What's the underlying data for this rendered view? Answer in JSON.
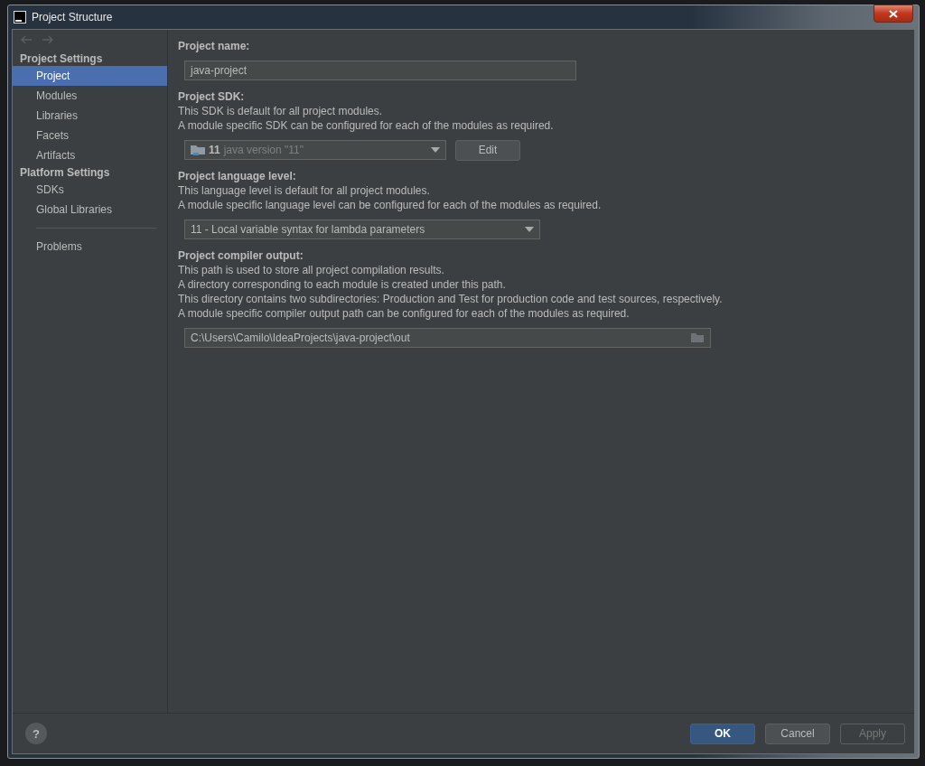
{
  "window": {
    "title": "Project Structure"
  },
  "sidebar": {
    "nav": [
      {
        "kind": "back",
        "disabled": true
      },
      {
        "kind": "forward",
        "disabled": true
      }
    ],
    "entries": [
      {
        "kind": "header",
        "label": "Project Settings"
      },
      {
        "kind": "item",
        "label": "Project",
        "selected": true
      },
      {
        "kind": "item",
        "label": "Modules",
        "selected": false
      },
      {
        "kind": "item",
        "label": "Libraries",
        "selected": false
      },
      {
        "kind": "item",
        "label": "Facets",
        "selected": false
      },
      {
        "kind": "item",
        "label": "Artifacts",
        "selected": false
      },
      {
        "kind": "header",
        "label": "Platform Settings"
      },
      {
        "kind": "item",
        "label": "SDKs",
        "selected": false
      },
      {
        "kind": "item",
        "label": "Global Libraries",
        "selected": false
      },
      {
        "kind": "divider"
      },
      {
        "kind": "item",
        "label": "Problems",
        "selected": false
      }
    ]
  },
  "sections": [
    {
      "kind": "text",
      "title": "Project name:",
      "value": "java-project"
    },
    {
      "kind": "sdk",
      "title": "Project SDK:",
      "lines": [
        "This SDK is default for all project modules.",
        "A module specific SDK can be configured for each of the modules as required."
      ],
      "sdk_version": "11",
      "sdk_name": "java version \"11\"",
      "button": "Edit"
    },
    {
      "kind": "combo",
      "title": "Project language level:",
      "lines": [
        "This language level is default for all project modules.",
        "A module specific language level can be configured for each of the modules as required."
      ],
      "value": "11 - Local variable syntax for lambda parameters"
    },
    {
      "kind": "path",
      "title": "Project compiler output:",
      "lines": [
        "This path is used to store all project compilation results.",
        "A directory corresponding to each module is created under this path.",
        "This directory contains two subdirectories: Production and Test for production code and test sources, respectively.",
        "A module specific compiler output path can be configured for each of the modules as required."
      ],
      "value": "C:\\Users\\Camilo\\IdeaProjects\\java-project\\out"
    }
  ],
  "footer": {
    "help": "?",
    "buttons": [
      {
        "label": "OK",
        "kind": "primary",
        "disabled": false
      },
      {
        "label": "Cancel",
        "kind": "normal",
        "disabled": false
      },
      {
        "label": "Apply",
        "kind": "normal",
        "disabled": true
      }
    ]
  }
}
